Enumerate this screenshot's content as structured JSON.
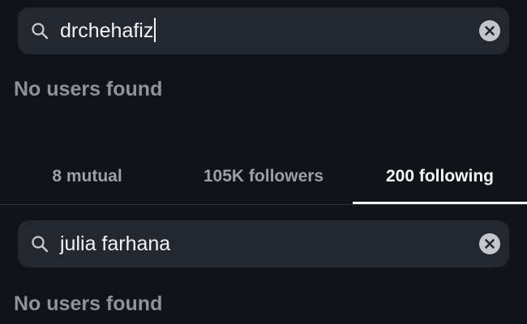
{
  "search_top": {
    "value": "drchehafiz",
    "icons": {
      "search": "search-icon",
      "clear": "clear-icon"
    }
  },
  "result_top": {
    "message": "No users found"
  },
  "tabs": [
    {
      "label": "8 mutual",
      "active": false
    },
    {
      "label": "105K followers",
      "active": false
    },
    {
      "label": "200 following",
      "active": true
    }
  ],
  "search_bottom": {
    "value": "julia farhana",
    "icons": {
      "search": "search-icon",
      "clear": "clear-icon"
    }
  },
  "result_bottom": {
    "message": "No users found"
  },
  "colors": {
    "background": "#101318",
    "search_field": "#232830",
    "active_text": "#f5f6f8",
    "inactive_text": "#9aa0a7",
    "muted_message": "#8e939a"
  }
}
